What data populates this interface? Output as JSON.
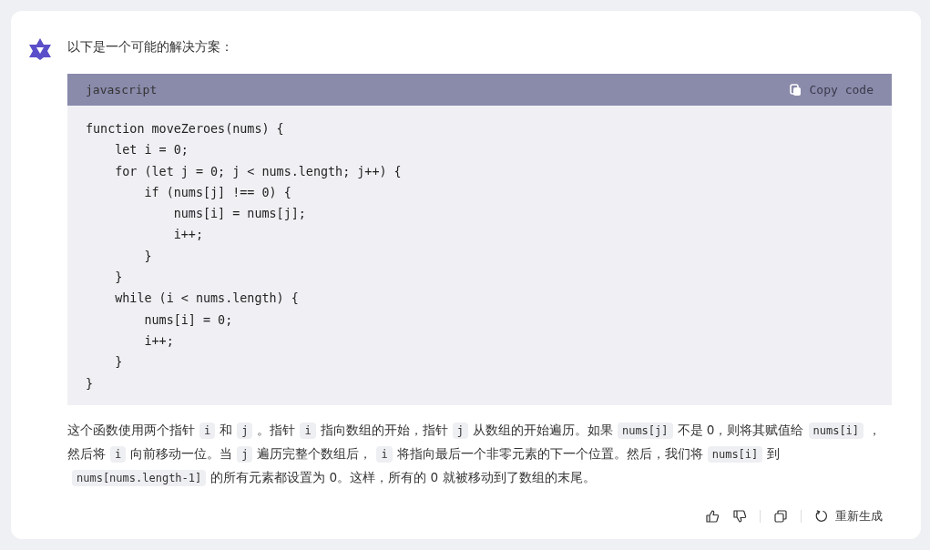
{
  "message": {
    "intro": "以下是一个可能的解决方案：",
    "code_block": {
      "language": "javascript",
      "copy_label": "Copy code",
      "lines": [
        "function moveZeroes(nums) {",
        "    let i = 0;",
        "    for (let j = 0; j < nums.length; j++) {",
        "        if (nums[j] !== 0) {",
        "            nums[i] = nums[j];",
        "            i++;",
        "        }",
        "    }",
        "    while (i < nums.length) {",
        "        nums[i] = 0;",
        "        i++;",
        "    }",
        "}"
      ]
    },
    "paragraph": [
      {
        "kind": "text",
        "text": "这个函数使用两个指针"
      },
      {
        "kind": "code",
        "text": "i"
      },
      {
        "kind": "text",
        "text": "和"
      },
      {
        "kind": "code",
        "text": "j"
      },
      {
        "kind": "text",
        "text": "。指针"
      },
      {
        "kind": "code",
        "text": "i"
      },
      {
        "kind": "text",
        "text": "指向数组的开始，指针"
      },
      {
        "kind": "code",
        "text": "j"
      },
      {
        "kind": "text",
        "text": "从数组的开始遍历。如果"
      },
      {
        "kind": "code",
        "text": "nums[j]"
      },
      {
        "kind": "text",
        "text": "不是 0，则将其赋值给"
      },
      {
        "kind": "code",
        "text": "nums[i]"
      },
      {
        "kind": "text",
        "text": "，然后将"
      },
      {
        "kind": "code",
        "text": "i"
      },
      {
        "kind": "text",
        "text": "向前移动一位。当"
      },
      {
        "kind": "code",
        "text": "j"
      },
      {
        "kind": "text",
        "text": "遍历完整个数组后，"
      },
      {
        "kind": "code",
        "text": "i"
      },
      {
        "kind": "text",
        "text": "将指向最后一个非零元素的下一个位置。然后，我们将"
      },
      {
        "kind": "code",
        "text": "nums[i]"
      },
      {
        "kind": "text",
        "text": "到"
      },
      {
        "kind": "code",
        "text": "nums[nums.length-1]"
      },
      {
        "kind": "text",
        "text": "的所有元素都设置为 0。这样，所有的 0 就被移动到了数组的末尾。"
      }
    ],
    "actions": {
      "regenerate_label": "重新生成"
    }
  }
}
